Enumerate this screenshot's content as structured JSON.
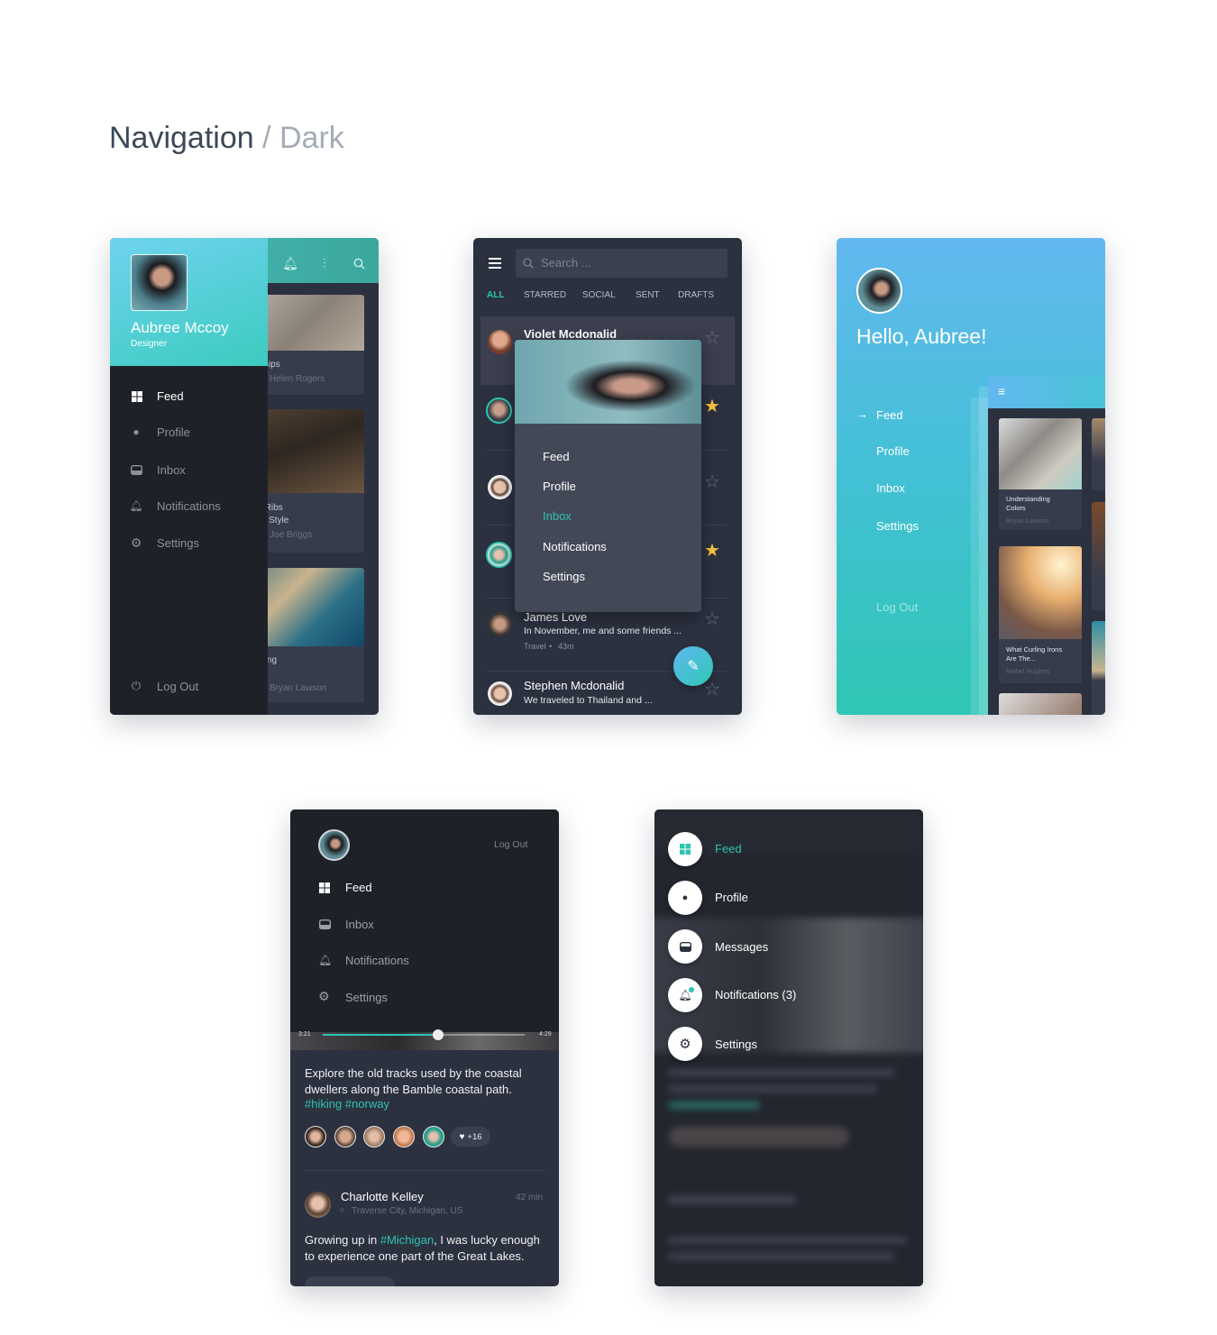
{
  "page": {
    "title_main": "Navigation",
    "title_sub": "/ Dark"
  },
  "colors": {
    "accent": "#2ec4b0",
    "dark_bg": "#2c3140",
    "drawer_bg": "#1f2128",
    "star": "#f7c33c",
    "gradient_top": "#63b8ef",
    "gradient_bottom": "#2fc6b5"
  },
  "drawer_panel": {
    "user_name": "Aubree Mccoy",
    "user_role": "Designer",
    "header_icons": [
      "bell-icon",
      "sliders-icon",
      "search-icon"
    ],
    "nav": [
      {
        "label": "Feed",
        "icon": "grid-icon",
        "active": true
      },
      {
        "label": "Profile",
        "icon": "user-icon"
      },
      {
        "label": "Inbox",
        "icon": "inbox-icon"
      },
      {
        "label": "Notifications",
        "icon": "bell-icon"
      },
      {
        "label": "Settings",
        "icon": "gear-icon"
      }
    ],
    "logout": "Log Out",
    "cards": [
      {
        "title": "Burn The Ships",
        "author": "Helen Rogers"
      },
      {
        "title": "Barbequed Ribs Kansas City Style",
        "author": "Joe Briggs"
      },
      {
        "title": "Understanding Colors",
        "author": "Bryan Lawson"
      }
    ]
  },
  "inbox_panel": {
    "search_placeholder": "Search ...",
    "tabs": [
      {
        "label": "ALL",
        "active": true
      },
      {
        "label": "STARRED"
      },
      {
        "label": "SOCIAL"
      },
      {
        "label": "SENT"
      },
      {
        "label": "DRAFTS"
      }
    ],
    "messages": [
      {
        "name": "Violet Mcdonalid",
        "starred": false
      },
      {
        "starred": true
      },
      {
        "starred": false
      },
      {
        "starred": true
      },
      {
        "name": "James Love",
        "preview": "In November, me and some friends ...",
        "tag": "Travel",
        "time": "43m",
        "starred": false
      },
      {
        "name": "Stephen Mcdonalid",
        "preview": "We traveled to Thailand and  ...",
        "starred": false
      }
    ],
    "menu": [
      {
        "label": "Feed"
      },
      {
        "label": "Profile"
      },
      {
        "label": "Inbox",
        "active": true
      },
      {
        "label": "Notifications"
      },
      {
        "label": "Settings"
      }
    ],
    "fab_icon": "pencil-icon"
  },
  "gradient_panel": {
    "greeting": "Hello, Aubree!",
    "nav": [
      {
        "label": "Feed",
        "active": true
      },
      {
        "label": "Profile"
      },
      {
        "label": "Inbox"
      },
      {
        "label": "Settings"
      }
    ],
    "logout": "Log Out",
    "cards": [
      {
        "title": "Understanding Colors",
        "author": "Bryan Lawson"
      },
      {
        "title": "What Curling Irons Are The...",
        "author": "Mabel Hughes"
      }
    ]
  },
  "topnav_panel": {
    "logout": "Log Out",
    "nav": [
      {
        "label": "Feed",
        "icon": "grid-icon",
        "active": true
      },
      {
        "label": "Inbox",
        "icon": "inbox-icon"
      },
      {
        "label": "Notifications",
        "icon": "bell-icon"
      },
      {
        "label": "Settings",
        "icon": "gear-icon"
      }
    ],
    "video": {
      "elapsed": "3:21",
      "total": "4:29",
      "progress": 0.57
    },
    "post1": {
      "text": "Explore the old tracks used by the coastal dwellers along the Bamble coastal path.",
      "tags": "#hiking #norway",
      "likes": "+16"
    },
    "post2": {
      "author": "Charlotte Kelley",
      "location": "Traverse City, Michigan, US",
      "time": "42 min",
      "text_before": "Growing up in ",
      "tag": "#Michigan",
      "text_after": ", I was lucky enough to experience one part of the Great Lakes."
    }
  },
  "fab_menu_panel": {
    "items": [
      {
        "label": "Feed",
        "icon": "grid-icon",
        "active": true
      },
      {
        "label": "Profile",
        "icon": "user-icon"
      },
      {
        "label": "Messages",
        "icon": "inbox-icon"
      },
      {
        "label": "Notifications (3)",
        "icon": "bell-icon",
        "badge": true
      },
      {
        "label": "Settings",
        "icon": "gear-icon"
      }
    ]
  }
}
